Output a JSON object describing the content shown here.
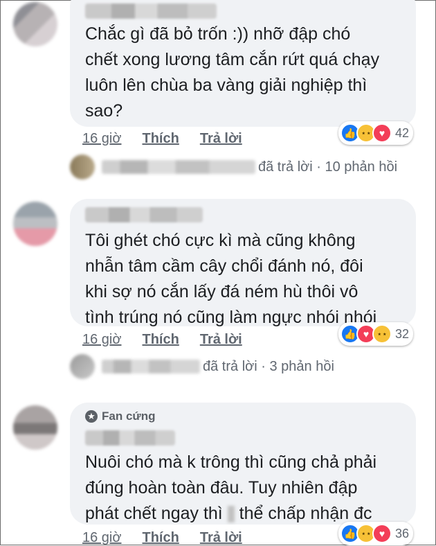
{
  "comments": [
    {
      "lines": [
        "Chắc gì đã bỏ trốn :)) nhỡ đập chó",
        "chết xong lương tâm cắn rứt quá chạy",
        "luôn lên chùa ba vàng giải nghiệp thì",
        "sao?"
      ],
      "time": "16 giờ",
      "like": "Thích",
      "reply": "Trả lời",
      "reaction_count": "42",
      "reactions": [
        "like-icon",
        "haha-icon",
        "love-icon"
      ],
      "reply_summary": "đã trả lời · 10 phản hồi"
    },
    {
      "lines": [
        "Tôi ghét chó cực kì mà cũng không",
        "nhẫn tâm cầm cây chổi đánh nó, đôi",
        "khi sợ nó cắn lấy đá ném hù thôi vô",
        "tình trúng nó cũng làm ngực nhói nhói"
      ],
      "time": "16 giờ",
      "like": "Thích",
      "reply": "Trả lời",
      "reaction_count": "32",
      "reactions": [
        "like-icon",
        "love-icon",
        "haha-icon"
      ],
      "reply_summary": "đã trả lời · 3 phản hồi"
    },
    {
      "badge": "Fan cứng",
      "line1": "Nuôi chó mà k trông thì cũng chả phải",
      "line2": "đúng hoàn toàn đâu. Tuy nhiên đập",
      "line3a": "phát chết ngay thì",
      "line3b": "thể chấp nhận đc",
      "time": "16 giờ",
      "like": "Thích",
      "reply": "Trả lời",
      "reaction_count": "36",
      "reactions": [
        "like-icon",
        "haha-icon",
        "love-icon"
      ]
    }
  ],
  "colors": {
    "like": "#1877f2",
    "love": "#f33e58",
    "haha": "#f7c137",
    "bubble": "#f0f2f5"
  }
}
